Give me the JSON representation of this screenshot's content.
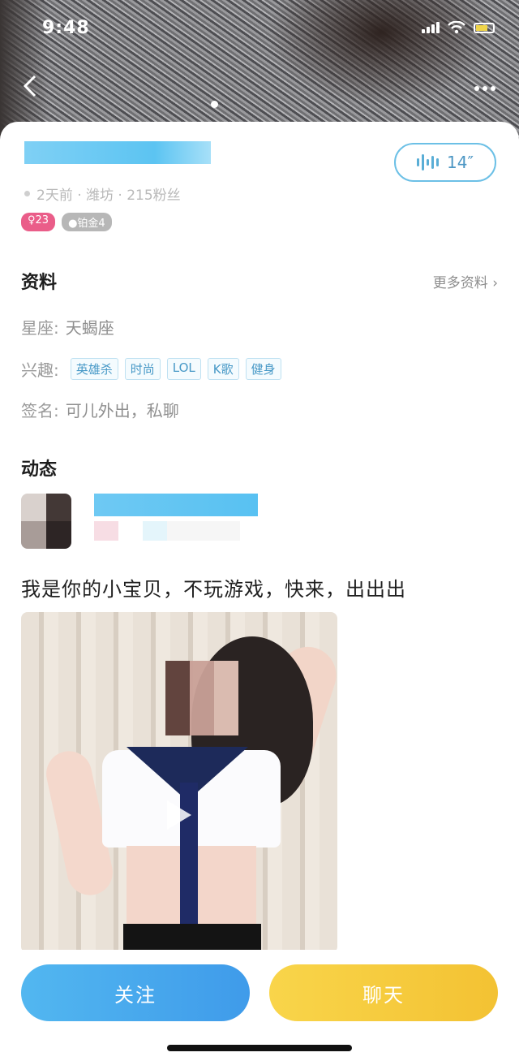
{
  "status_bar": {
    "time": "9:48"
  },
  "header": {
    "back_icon": "chevron-left-icon",
    "more_icon": "more-dots-icon"
  },
  "profile": {
    "voice_duration": "14″",
    "meta": "2天前 · 潍坊 · 215粉丝",
    "age_badge": "♀23",
    "level_badge": "●铂金4"
  },
  "info_section": {
    "title": "资料",
    "more_label": "更多资料 ›",
    "zodiac_label": "星座:",
    "zodiac_value": "天蝎座",
    "interests_label": "兴趣:",
    "interests": [
      "英雄杀",
      "时尚",
      "LOL",
      "K歌",
      "健身"
    ],
    "signature_label": "签名:",
    "signature_value": "可儿外出，私聊"
  },
  "feed_section": {
    "title": "动态",
    "post_text": "我是你的小宝贝，不玩游戏，快来，出出出"
  },
  "actions": {
    "follow_label": "关注",
    "chat_label": "聊天"
  },
  "colors": {
    "follow_button": "#4aa8ef",
    "chat_button": "#f6cb3c",
    "tag_text": "#4899c7",
    "age_badge": "#ea5d89"
  }
}
